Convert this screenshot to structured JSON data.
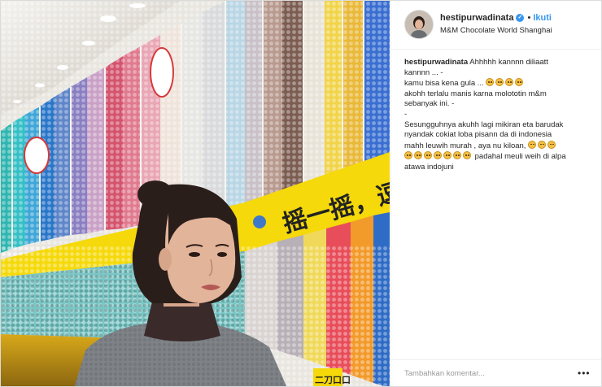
{
  "post": {
    "username": "hestipurwadinata",
    "follow_label": "Ikuti",
    "location": "M&M Chocolate World Shanghai",
    "separator": "•"
  },
  "caption": {
    "username": "hestipurwadinata",
    "line1": "Ahhhhh kannnn diliaatt",
    "line2": "kannnn ... -",
    "line3": "kamu bisa kena gula ...",
    "line4": "akohh terlalu manis karna molototin m&m",
    "line5": "sebanyak ini. -",
    "line6": "-",
    "line7": "Sesungguhnya akuhh lagi mikiran eta barudak",
    "line8": "nyandak cokiat loba pisann da di indonesia",
    "line9": "mahh leuwih murah , aya nu kiloan,",
    "line10": "padahal meuli weih di alpa",
    "line11": "atawa indojuni"
  },
  "photo": {
    "sign_text": "摇一摇，逗趣不",
    "bottom_sign_text": "二刀口口"
  },
  "comment": {
    "placeholder": "Tambahkan komentar...",
    "more_label": "•••"
  },
  "colors": {
    "link_blue": "#3897f0",
    "text": "#262626",
    "border": "#dbdbdb",
    "sign_yellow": "#f5d90a"
  }
}
